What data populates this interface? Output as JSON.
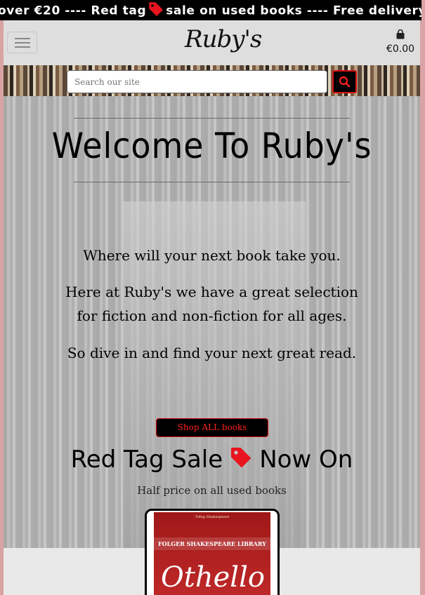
{
  "ticker": {
    "before": "over €20 ---- Red tag",
    "after": "sale on used books ---- Free delivery o"
  },
  "navbar": {
    "brand": "Ruby's",
    "cart_total": "€0.00",
    "icons": [
      "hamburger-menu-icon",
      "shopping-bag-icon"
    ]
  },
  "search": {
    "placeholder": "Search our site",
    "icon": "search-icon"
  },
  "hero": {
    "welcome": "Welcome To Ruby's",
    "line1": "Where will your next book take you.",
    "line2a": "Here at Ruby's we have a great selection",
    "line2b": "for fiction and non-fiction for all ages.",
    "line3": "So dive in and find your next great read.",
    "shop_button": "Shop ALL books",
    "sale_before": "Red Tag Sale",
    "sale_after": "Now On",
    "sale_sub": "Half price on all used books"
  },
  "book": {
    "author": "Tiếng Shakespeare",
    "series": "FOLGER SHAKESPEARE LIBRARY",
    "title": "Othello"
  },
  "colors": {
    "accent_red": "#d71010",
    "tag_red": "#e8141e",
    "dark": "#000000"
  }
}
